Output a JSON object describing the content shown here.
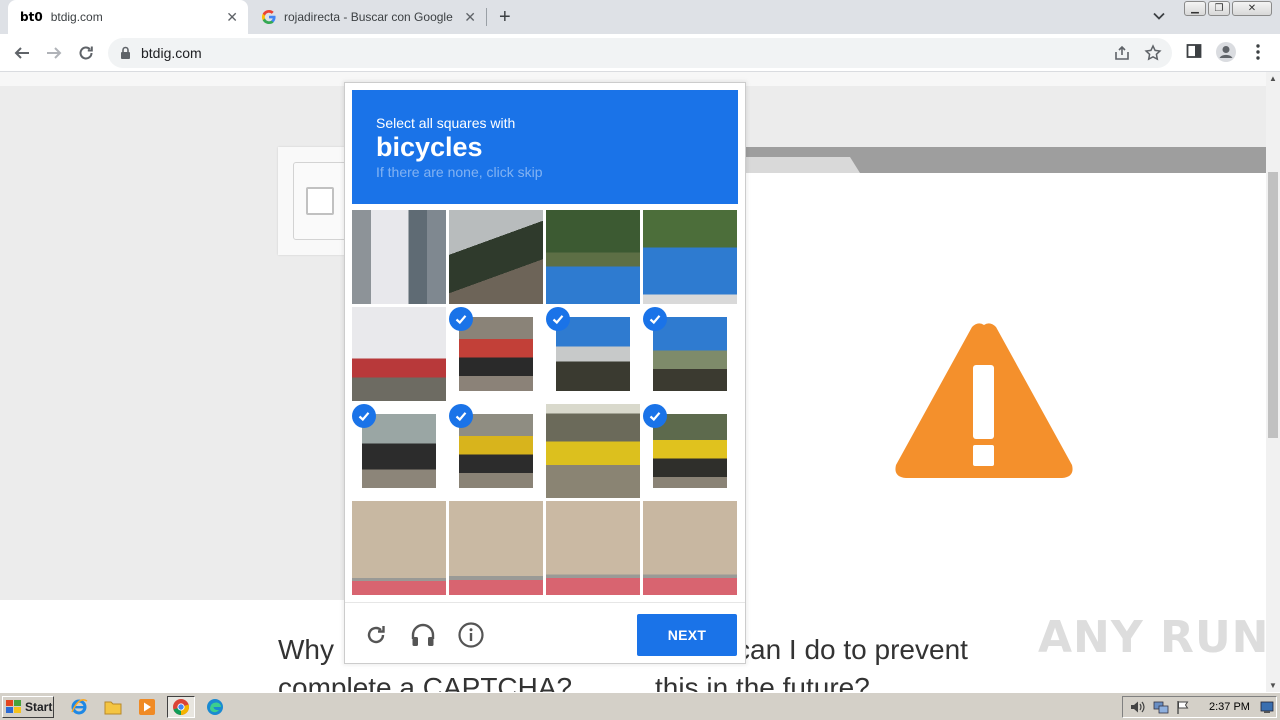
{
  "browser": {
    "tabs": [
      {
        "title": "btdig.com",
        "favicon": "bt0",
        "active": true
      },
      {
        "title": "rojadirecta - Buscar con Google",
        "favicon": "G",
        "active": false
      }
    ],
    "url": "btdig.com"
  },
  "captcha": {
    "line1": "Select all squares with",
    "target": "bicycles",
    "line3": "If there are none, click skip",
    "next_label": "NEXT",
    "selected_cells": [
      5,
      6,
      7,
      8,
      9,
      11
    ]
  },
  "page": {
    "heading_left_1": "Why",
    "heading_left_2": "complete a CAPTCHA?",
    "heading_right_1": "can I do to prevent",
    "heading_right_2": "this in the future?"
  },
  "watermark": "ANY RUN",
  "taskbar": {
    "start_label": "Start",
    "clock": "2:37 PM"
  },
  "colors": {
    "accent": "#1a73e8",
    "warning": "#f4902c"
  }
}
